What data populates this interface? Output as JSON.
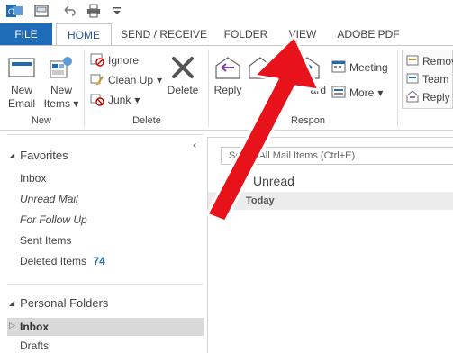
{
  "tabs": [
    "FILE",
    "HOME",
    "SEND / RECEIVE",
    "FOLDER",
    "VIEW",
    "ADOBE PDF"
  ],
  "ribbon": {
    "new_email": "New\nEmail",
    "new_email_l1": "New",
    "new_email_l2": "Email",
    "new_items_l1": "New",
    "new_items_l2": "Items",
    "group_new": "New",
    "ignore": "Ignore",
    "clean_up": "Clean Up",
    "junk": "Junk",
    "delete": "Delete",
    "group_delete": "Delete",
    "reply": "Reply",
    "forward_partial": "ard",
    "meeting": "Meeting",
    "more": "More",
    "group_respond_partial": "Respon",
    "remove_partial": "Remov",
    "team_partial": "Team",
    "reply_partial": "Reply"
  },
  "folder_pane": {
    "favorites": "Favorites",
    "inbox": "Inbox",
    "unread_mail": "Unread Mail",
    "for_follow_up": "For Follow Up",
    "sent_items": "Sent Items",
    "deleted_items": "Deleted Items",
    "deleted_count": "74",
    "personal_folders": "Personal Folders",
    "pf_inbox": "Inbox",
    "drafts": "Drafts"
  },
  "message_list": {
    "search_placeholder": "Search All Mail Items (Ctrl+E)",
    "search_visible": "Se",
    "search_tail": "All Mail Items (Ctrl+E)",
    "filter_unread": "Unread",
    "group_today": "Today"
  },
  "colors": {
    "file_tab": "#1e6bb8",
    "accent_blue": "#2b579a",
    "arrow_red": "#e8121a"
  }
}
